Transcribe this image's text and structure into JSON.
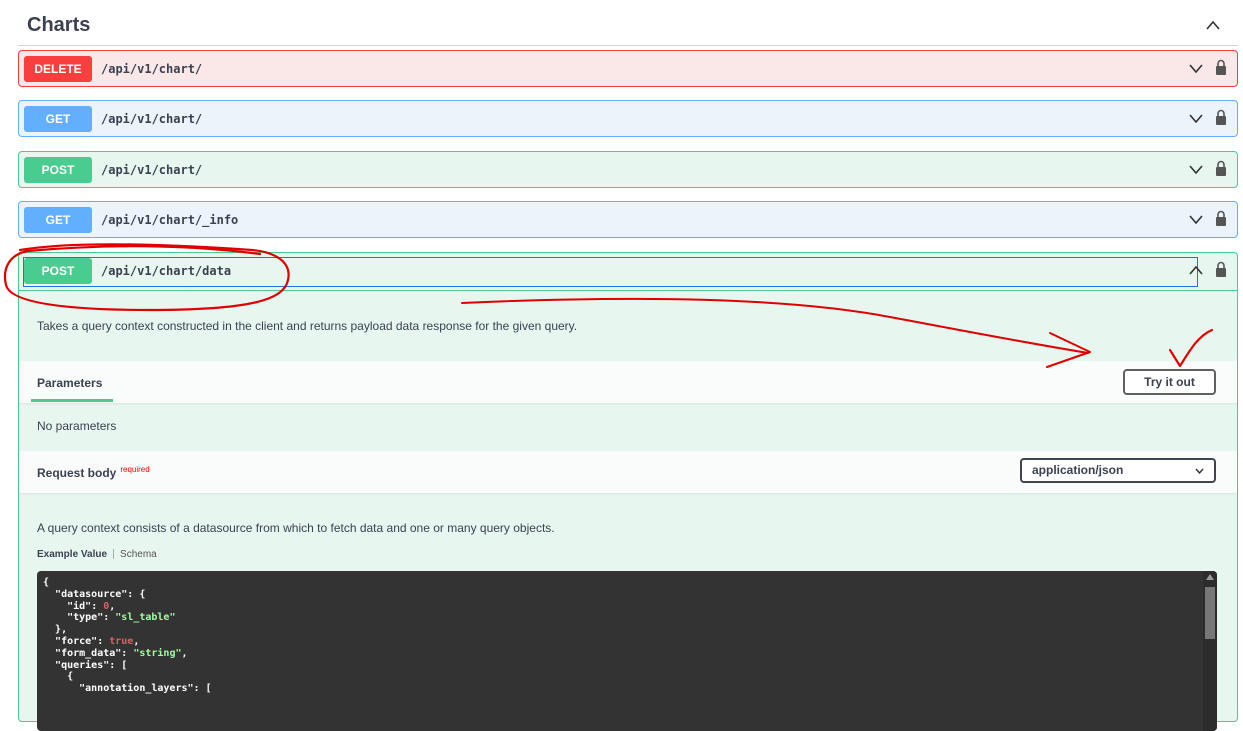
{
  "section": {
    "title": "Charts"
  },
  "operations": [
    {
      "method": "DELETE",
      "path": "/api/v1/chart/"
    },
    {
      "method": "GET",
      "path": "/api/v1/chart/"
    },
    {
      "method": "POST",
      "path": "/api/v1/chart/"
    },
    {
      "method": "GET",
      "path": "/api/v1/chart/_info"
    }
  ],
  "expanded_op": {
    "method": "POST",
    "path": "/api/v1/chart/data",
    "description": "Takes a query context constructed in the client and returns payload data response for the given query.",
    "parameters_label": "Parameters",
    "try_label": "Try it out",
    "no_params": "No parameters",
    "request_body_label": "Request body",
    "required_label": "required",
    "content_type": "application/json",
    "body_description": "A query context consists of a datasource from which to fetch data and one or many query objects.",
    "example_tab": "Example Value",
    "schema_tab": "Schema"
  },
  "colors": {
    "delete": "#f93e3e",
    "get": "#61affe",
    "post": "#49cc90",
    "annotation": "#e00000"
  }
}
